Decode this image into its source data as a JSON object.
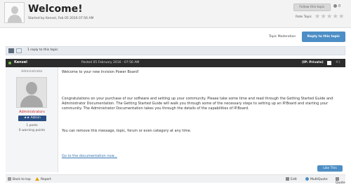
{
  "topic": {
    "title": "Welcome!",
    "started_by": "Started by Kensel, Feb 05 2016 07:56 AM",
    "follow_label": "Follow this topic",
    "follow_count": "0",
    "rate_label": "Rate Topic",
    "stars": "★★★★★"
  },
  "moderation": {
    "topic_moderation_label": "Topic Moderation",
    "reply_label": "Reply to this topic"
  },
  "replies": {
    "text": "1 reply to this topic"
  },
  "post": {
    "author": "Kensel",
    "posted": "Posted 05 February 2016 - 07:56 AM",
    "ip_label": "(IP: Private)",
    "number": "#1",
    "user": {
      "title": "Administrator",
      "group": "Administrators",
      "badge": "★★ Admin",
      "posts": "1 posts",
      "warning_points": "0 warning points"
    },
    "body": {
      "p1": "Welcome to your new Invision Power Board!",
      "p2": "Congratulations on your purchase of our software and setting up your community. Please take some time and read through the Getting Started Guide and Administrator Documentation. The Getting Started Guide will walk you through some of the necessary steps to setting up an IP.Board and starting your community. The Administrator Documentation takes you through the details of the capabilities of IP.Board.",
      "p3": "You can remove this message, topic, forum or even category at any time.",
      "link": "Go to the documentation now..."
    },
    "like_label": "Like This"
  },
  "footer": {
    "back_to_top": "Back to top",
    "report": "Report",
    "edit": "Edit",
    "multiquote": "MultiQuote",
    "quote": "Quote"
  },
  "colors": {
    "accent": "#4c8ec5",
    "post_header": "#2c2c2c",
    "group_color": "#cc3333"
  }
}
